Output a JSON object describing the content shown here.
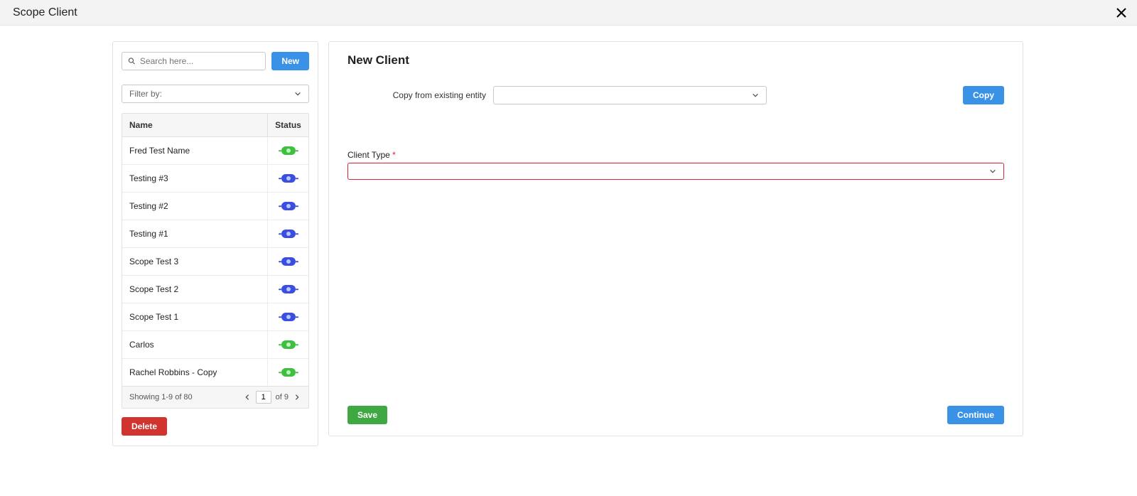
{
  "header": {
    "title": "Scope Client"
  },
  "sidebar": {
    "search_placeholder": "Search here...",
    "new_button_label": "New",
    "filter_label": "Filter by:",
    "columns": {
      "name": "Name",
      "status": "Status"
    },
    "rows": [
      {
        "name": "Fred Test Name",
        "status": "green"
      },
      {
        "name": "Testing #3",
        "status": "blue"
      },
      {
        "name": "Testing #2",
        "status": "blue"
      },
      {
        "name": "Testing #1",
        "status": "blue"
      },
      {
        "name": "Scope Test 3",
        "status": "blue"
      },
      {
        "name": "Scope Test 2",
        "status": "blue"
      },
      {
        "name": "Scope Test 1",
        "status": "blue"
      },
      {
        "name": "Carlos",
        "status": "green"
      },
      {
        "name": "Rachel Robbins - Copy",
        "status": "green"
      }
    ],
    "pager": {
      "showing": "Showing 1-9 of 80",
      "page": "1",
      "of_pages": "of 9"
    },
    "delete_label": "Delete"
  },
  "main": {
    "title": "New Client",
    "copy_label": "Copy from existing entity",
    "copy_button_label": "Copy",
    "client_type_label": "Client Type",
    "save_label": "Save",
    "continue_label": "Continue"
  }
}
